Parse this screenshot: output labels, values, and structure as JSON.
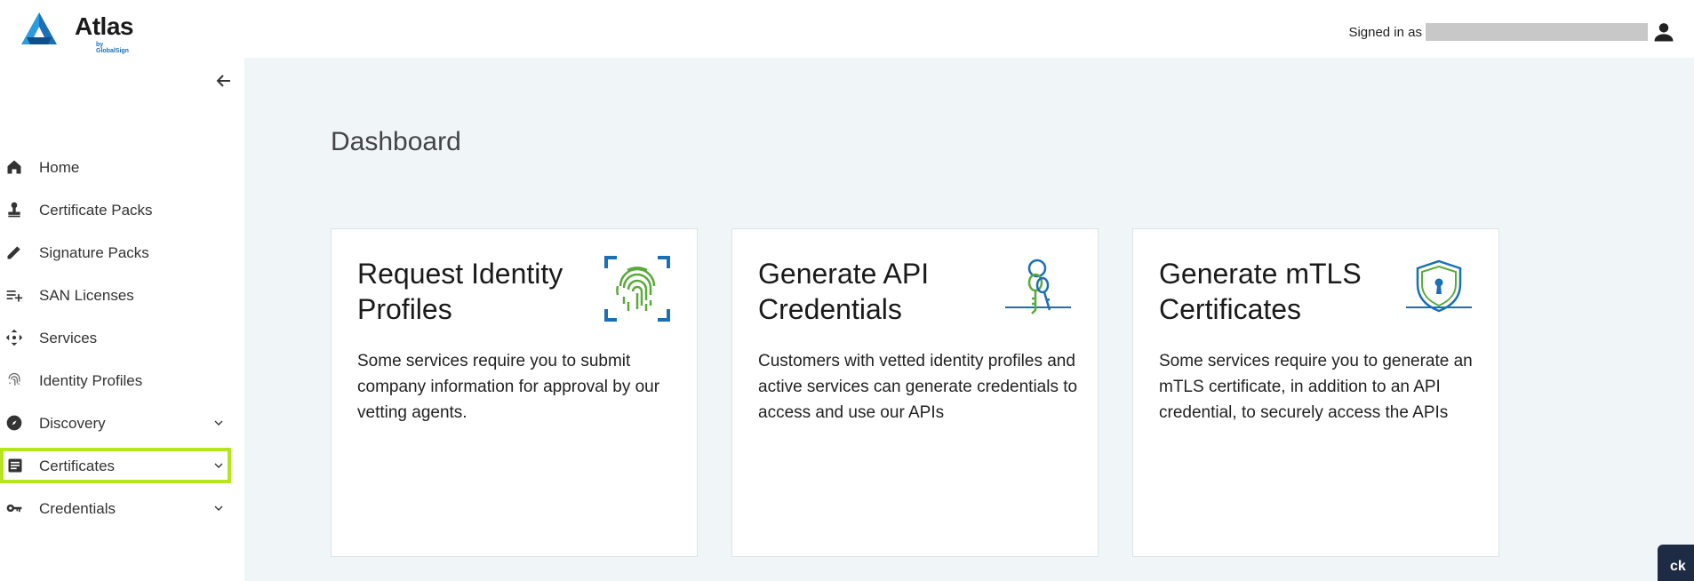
{
  "app": {
    "logo_text": "Atlas",
    "logo_sub": "by GlobalSign"
  },
  "header": {
    "signed_in_label": "Signed in as"
  },
  "sidebar": {
    "items": [
      {
        "label": "Home",
        "icon": "home-icon"
      },
      {
        "label": "Certificate Packs",
        "icon": "stamp-icon"
      },
      {
        "label": "Signature Packs",
        "icon": "pencil-icon"
      },
      {
        "label": "SAN Licenses",
        "icon": "playlist-add-icon"
      },
      {
        "label": "Services",
        "icon": "move-arrows-icon"
      },
      {
        "label": "Identity Profiles",
        "icon": "fingerprint-icon"
      },
      {
        "label": "Discovery",
        "icon": "compass-icon",
        "expandable": true
      },
      {
        "label": "Certificates",
        "icon": "document-icon",
        "expandable": true,
        "selected": true
      },
      {
        "label": "Credentials",
        "icon": "key-icon",
        "expandable": true
      }
    ]
  },
  "main": {
    "title": "Dashboard",
    "cards": [
      {
        "title": "Request Identity Profiles",
        "description": "Some services require you to submit company information for approval by our vetting agents.",
        "icon": "fingerprint-scan-icon"
      },
      {
        "title": "Generate API Credentials",
        "description": "Customers with vetted identity profiles and active services can generate credentials to access and use our APIs",
        "icon": "keys-icon"
      },
      {
        "title": "Generate mTLS Certificates",
        "description": "Some services require you to generate an mTLS certificate, in addition to an API credential, to securely access the APIs",
        "icon": "shield-lock-icon"
      }
    ]
  },
  "feedback": {
    "label": "ck"
  },
  "colors": {
    "accent_green": "#b5e61d",
    "brand_blue": "#1a6fb5",
    "main_bg": "#f0f5f8",
    "feedback_bg": "#1d2b44"
  }
}
